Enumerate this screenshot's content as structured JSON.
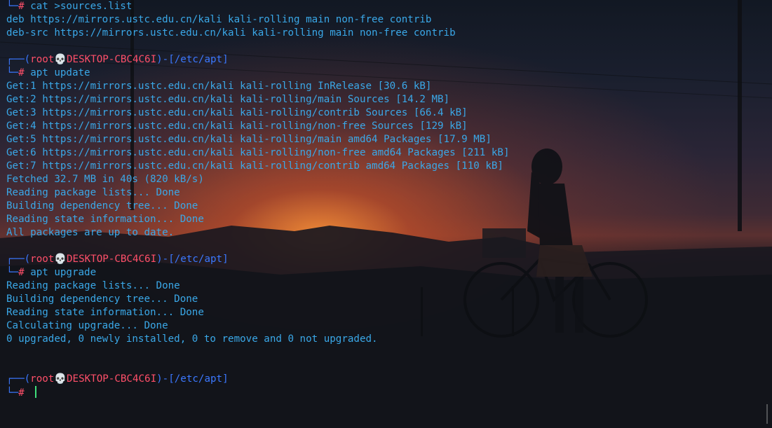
{
  "colors": {
    "text": "#3aa8e8",
    "box": "#3b78ff",
    "user": "#ff4f69",
    "cursor": "#3fe07b"
  },
  "lines": [
    {
      "type": "cmd",
      "text": "cat >sources.list"
    },
    {
      "type": "out",
      "text": "deb https://mirrors.ustc.edu.cn/kali kali-rolling main non-free contrib"
    },
    {
      "type": "out",
      "text": "deb-src https://mirrors.ustc.edu.cn/kali kali-rolling main non-free contrib"
    },
    {
      "type": "blank"
    },
    {
      "type": "prompt",
      "open": "┌──(",
      "user": "root",
      "skull": "💀",
      "host": "DESKTOP-CBC4C6I",
      "mid": ")-[",
      "path": "/etc/apt",
      "close": "]"
    },
    {
      "type": "cmd",
      "text": "apt update"
    },
    {
      "type": "out",
      "text": "Get:1 https://mirrors.ustc.edu.cn/kali kali-rolling InRelease [30.6 kB]"
    },
    {
      "type": "out",
      "text": "Get:2 https://mirrors.ustc.edu.cn/kali kali-rolling/main Sources [14.2 MB]"
    },
    {
      "type": "out",
      "text": "Get:3 https://mirrors.ustc.edu.cn/kali kali-rolling/contrib Sources [66.4 kB]"
    },
    {
      "type": "out",
      "text": "Get:4 https://mirrors.ustc.edu.cn/kali kali-rolling/non-free Sources [129 kB]"
    },
    {
      "type": "out",
      "text": "Get:5 https://mirrors.ustc.edu.cn/kali kali-rolling/main amd64 Packages [17.9 MB]"
    },
    {
      "type": "out",
      "text": "Get:6 https://mirrors.ustc.edu.cn/kali kali-rolling/non-free amd64 Packages [211 kB]"
    },
    {
      "type": "out",
      "text": "Get:7 https://mirrors.ustc.edu.cn/kali kali-rolling/contrib amd64 Packages [110 kB]"
    },
    {
      "type": "out",
      "text": "Fetched 32.7 MB in 40s (820 kB/s)"
    },
    {
      "type": "out",
      "text": "Reading package lists... Done"
    },
    {
      "type": "out",
      "text": "Building dependency tree... Done"
    },
    {
      "type": "out",
      "text": "Reading state information... Done"
    },
    {
      "type": "out",
      "text": "All packages are up to date."
    },
    {
      "type": "blank"
    },
    {
      "type": "prompt",
      "open": "┌──(",
      "user": "root",
      "skull": "💀",
      "host": "DESKTOP-CBC4C6I",
      "mid": ")-[",
      "path": "/etc/apt",
      "close": "]"
    },
    {
      "type": "cmd",
      "text": "apt upgrade"
    },
    {
      "type": "out",
      "text": "Reading package lists... Done"
    },
    {
      "type": "out",
      "text": "Building dependency tree... Done"
    },
    {
      "type": "out",
      "text": "Reading state information... Done"
    },
    {
      "type": "out",
      "text": "Calculating upgrade... Done"
    },
    {
      "type": "out",
      "text": "0 upgraded, 0 newly installed, 0 to remove and 0 not upgraded."
    },
    {
      "type": "blank"
    },
    {
      "type": "blank"
    },
    {
      "type": "prompt",
      "open": "┌──(",
      "user": "root",
      "skull": "💀",
      "host": "DESKTOP-CBC4C6I",
      "mid": ")-[",
      "path": "/etc/apt",
      "close": "]"
    },
    {
      "type": "input",
      "text": ""
    }
  ],
  "cmd_prefix": "└─",
  "cmd_hash": "#"
}
